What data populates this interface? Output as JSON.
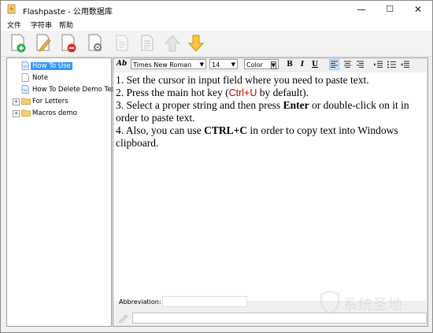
{
  "window": {
    "title": "Flashpaste - 公用数据库",
    "minimize": "—",
    "maximize": "☐",
    "close": "✕"
  },
  "menu": [
    {
      "label": "文件"
    },
    {
      "label": "字符串"
    },
    {
      "label": "帮助"
    }
  ],
  "toolbar": {
    "buttons": [
      "add-item",
      "edit-item",
      "delete-item",
      "settings",
      "edit-disabled",
      "properties-disabled",
      "move-up",
      "move-down"
    ]
  },
  "tree": {
    "items": [
      {
        "label": "How To Use",
        "type": "doc",
        "selected": true
      },
      {
        "label": "Note",
        "type": "doc"
      },
      {
        "label": "How To Delete Demo Text",
        "type": "doc"
      },
      {
        "label": "For Letters",
        "type": "folder",
        "expander": "+"
      },
      {
        "label": "Macros demo",
        "type": "folder",
        "expander": "+"
      }
    ]
  },
  "format_bar": {
    "style_label": "Ab",
    "font": "Times New Roman",
    "size": "14",
    "color": "Color",
    "bold": "B",
    "italic": "I",
    "underline": "U"
  },
  "editor_text": {
    "l1": "1. Set the cursor in input field where you need to paste text.",
    "l2a": "2. Press the main hot key (",
    "l2b": "Ctrl+U",
    "l2c": " by default).",
    "l3a": "3. Select a proper string and then press ",
    "l3b": "Enter",
    "l3c": " or double-click on it in order to paste text.",
    "l4a": " 4. Also, you can use ",
    "l4b": "CTRL+C",
    "l4c": " in order to copy text into Windows clipboard."
  },
  "abbreviation": {
    "label": "Abbreviation:",
    "value": ""
  },
  "watermark": {
    "text": "系统圣地"
  },
  "colors": {
    "selection": "#3399ff",
    "hotkey": "#cc0000",
    "arrow": "#f5c542"
  }
}
